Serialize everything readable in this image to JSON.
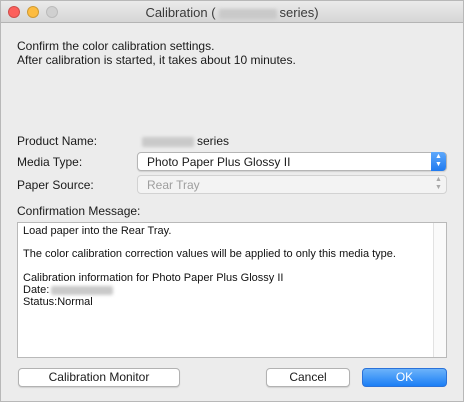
{
  "window": {
    "title_prefix": "Calibration (",
    "title_suffix": "series)"
  },
  "intro": {
    "line1": "Confirm the color calibration settings.",
    "line2": "After calibration is started, it takes about 10 minutes."
  },
  "form": {
    "product_name_label": "Product Name:",
    "product_name_suffix": "series",
    "media_type_label": "Media Type:",
    "media_type_value": "Photo Paper Plus Glossy II",
    "paper_source_label": "Paper Source:",
    "paper_source_value": "Rear Tray",
    "confirmation_label": "Confirmation Message:"
  },
  "message": {
    "line1": "Load paper into the Rear Tray.",
    "line2": "The color calibration correction values will be applied to only this media type.",
    "line3": "Calibration information for Photo Paper Plus Glossy II",
    "line4": " Date:",
    "line5": " Status:Normal"
  },
  "buttons": {
    "calibration_monitor": "Calibration Monitor",
    "cancel": "Cancel",
    "ok": "OK"
  },
  "icons": {
    "select_arrows": "up-down-chevron-icon",
    "window_controls": [
      "close-icon",
      "minimize-icon",
      "zoom-icon"
    ]
  },
  "colors": {
    "accent": "#1f7af0",
    "window_bg": "#ececec"
  }
}
